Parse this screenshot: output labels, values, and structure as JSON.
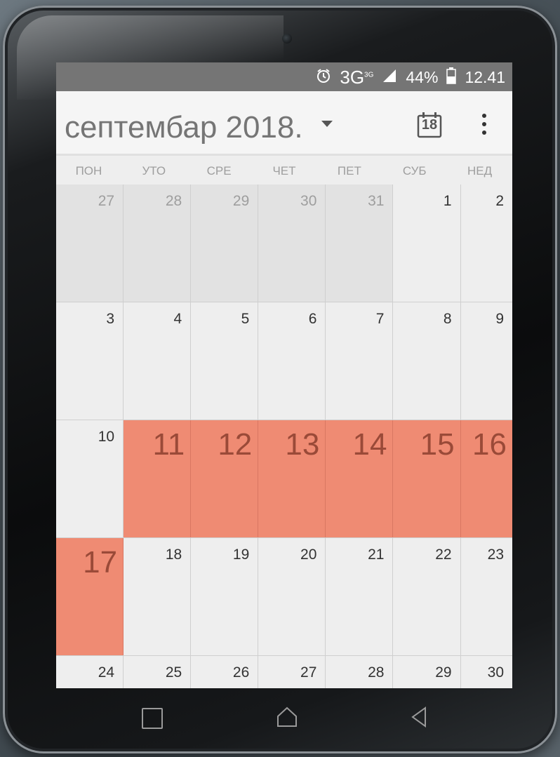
{
  "status_bar": {
    "alarm_icon": "alarm-clock-icon",
    "network": "3G",
    "network_sub": "3G",
    "battery": "44%",
    "time": "12.41"
  },
  "header": {
    "month_title": "септембар 2018.",
    "today_day": "18",
    "today_icon": "calendar-today-icon",
    "more_icon": "more-vert-icon"
  },
  "weekdays": [
    "ПОН",
    "УТО",
    "СРЕ",
    "ЧЕТ",
    "ПЕТ",
    "СУБ",
    "НЕД"
  ],
  "weeks": [
    [
      {
        "d": "27",
        "other": true
      },
      {
        "d": "28",
        "other": true
      },
      {
        "d": "29",
        "other": true
      },
      {
        "d": "30",
        "other": true
      },
      {
        "d": "31",
        "other": true
      },
      {
        "d": "1"
      },
      {
        "d": "2"
      }
    ],
    [
      {
        "d": "3"
      },
      {
        "d": "4"
      },
      {
        "d": "5"
      },
      {
        "d": "6"
      },
      {
        "d": "7"
      },
      {
        "d": "8"
      },
      {
        "d": "9"
      }
    ],
    [
      {
        "d": "10"
      },
      {
        "d": "11",
        "hl": true
      },
      {
        "d": "12",
        "hl": true
      },
      {
        "d": "13",
        "hl": true
      },
      {
        "d": "14",
        "hl": true
      },
      {
        "d": "15",
        "hl": true
      },
      {
        "d": "16",
        "hl": true
      }
    ],
    [
      {
        "d": "17",
        "hl": true
      },
      {
        "d": "18"
      },
      {
        "d": "19"
      },
      {
        "d": "20"
      },
      {
        "d": "21"
      },
      {
        "d": "22"
      },
      {
        "d": "23"
      }
    ],
    [
      {
        "d": "24"
      },
      {
        "d": "25"
      },
      {
        "d": "26"
      },
      {
        "d": "27"
      },
      {
        "d": "28"
      },
      {
        "d": "29"
      },
      {
        "d": "30"
      }
    ]
  ],
  "colors": {
    "highlight": "#ef8b73",
    "status_bar": "#757575",
    "grid_bg": "#eeeeee"
  },
  "nav_bar": {
    "recent_icon": "recent-apps-icon",
    "home_icon": "home-icon",
    "back_icon": "back-icon"
  }
}
